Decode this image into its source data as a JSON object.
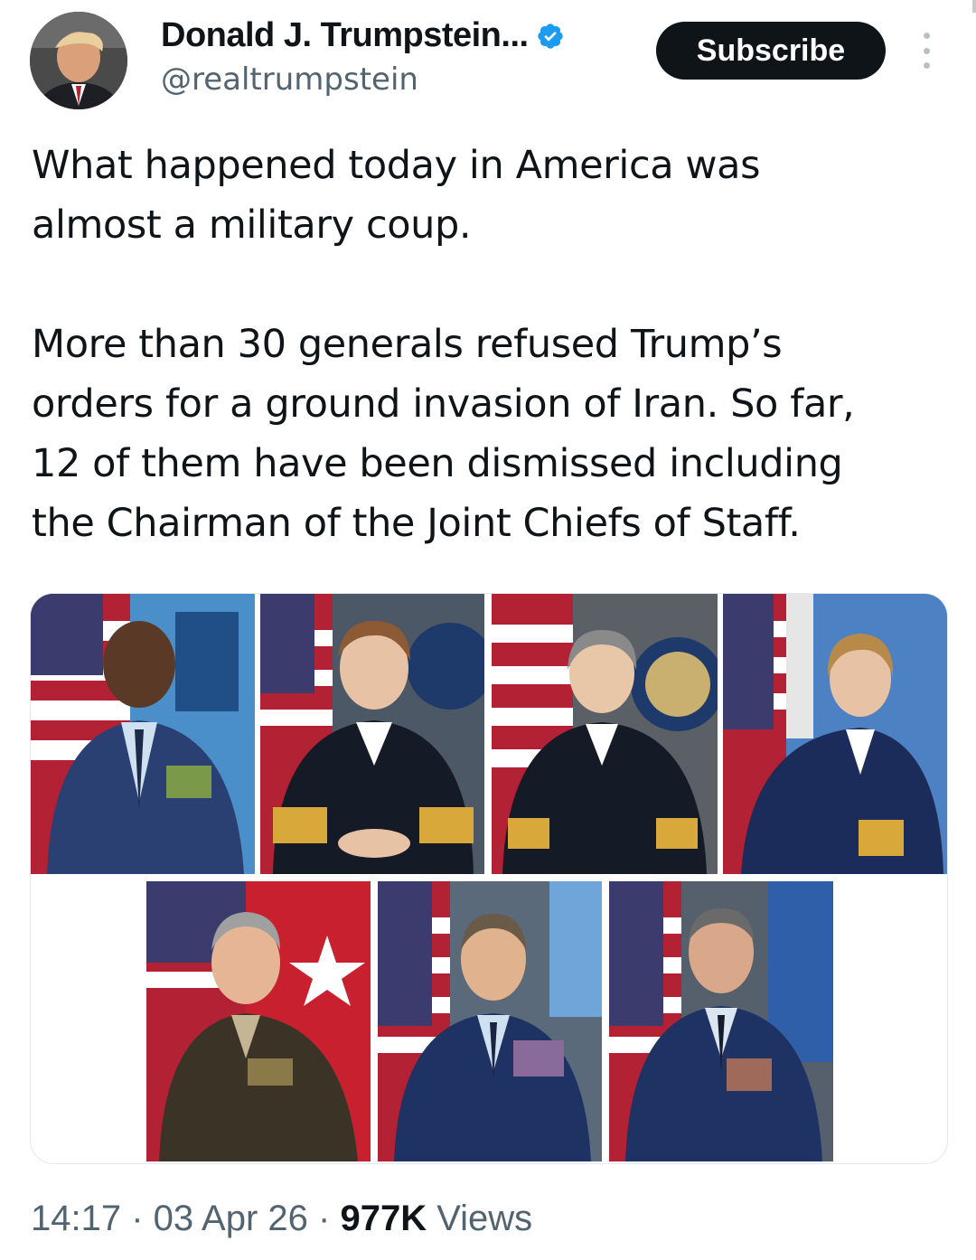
{
  "author": {
    "display_name": "Donald J. Trumpstein...",
    "handle": "@realtrumpstein",
    "verified": true,
    "avatar_icon": "profile-photo"
  },
  "actions": {
    "subscribe_label": "Subscribe",
    "more_icon": "more-vertical-icon"
  },
  "tweet": {
    "paragraph_1": "What happened today in America was\nalmost a military coup.",
    "paragraph_2": "More than 30 generals refused Trump’s\norders for a ground invasion of Iran. So far,\n12 of them have been dismissed including\nthe Chairman of the Joint Chiefs of Staff."
  },
  "media": {
    "photos": [
      {
        "description": "air-force-general-portrait"
      },
      {
        "description": "navy-admiral-portrait"
      },
      {
        "description": "navy-admiral-portrait"
      },
      {
        "description": "coast-guard-admiral-portrait"
      },
      {
        "description": "army-general-portrait"
      },
      {
        "description": "air-force-general-portrait"
      },
      {
        "description": "air-force-general-portrait"
      }
    ]
  },
  "meta": {
    "time": "14:17",
    "separator": " · ",
    "date": "03 Apr 26",
    "views_count": "977K",
    "views_label": " Views"
  },
  "colors": {
    "text": "#0f1419",
    "secondary": "#536471",
    "verified_blue": "#1d9bf0",
    "button_bg": "#0f1419"
  }
}
